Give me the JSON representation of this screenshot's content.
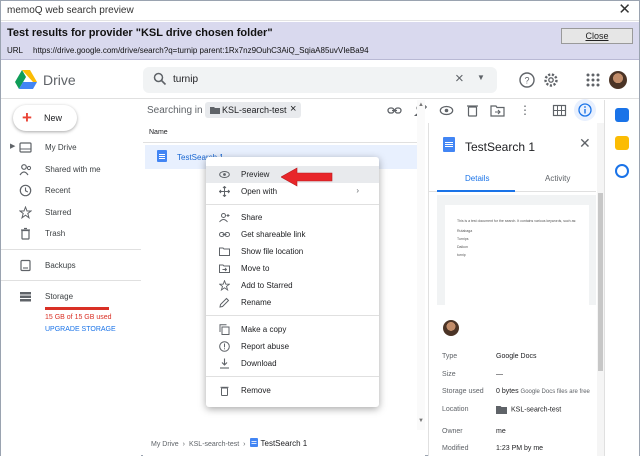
{
  "window": {
    "title": "memoQ web search preview",
    "heading": "Test results for provider \"KSL drive chosen folder\"",
    "url_label": "URL",
    "url": "https://drive.google.com/drive/search?q=turnip parent:1Rx7nz9OuhC3AiQ_SqiaA85uvVIeBa94",
    "close_label": "Close"
  },
  "header": {
    "logo_text": "Drive",
    "search_value": "turnip"
  },
  "sidebar": {
    "new_label": "New",
    "items": [
      {
        "label": "My Drive",
        "icon": "my-drive-icon"
      },
      {
        "label": "Shared with me",
        "icon": "shared-icon"
      },
      {
        "label": "Recent",
        "icon": "clock-icon"
      },
      {
        "label": "Starred",
        "icon": "star-icon"
      },
      {
        "label": "Trash",
        "icon": "trash-icon"
      }
    ],
    "backups_label": "Backups",
    "storage_label": "Storage",
    "storage_used": "15 GB of 15 GB used",
    "upgrade_label": "UPGRADE STORAGE"
  },
  "main": {
    "searching_in": "Searching in",
    "chip_label": "KSL-search-test",
    "column_name": "Name",
    "file_name": "TestSearch 1",
    "breadcrumb": [
      "My Drive",
      "KSL-search-test",
      "TestSearch 1"
    ]
  },
  "context_menu": {
    "items": [
      {
        "label": "Preview",
        "icon": "eye-icon"
      },
      {
        "label": "Open with",
        "icon": "move-arrows-icon"
      },
      {
        "label": "Share",
        "icon": "person-add-icon"
      },
      {
        "label": "Get shareable link",
        "icon": "link-icon"
      },
      {
        "label": "Show file location",
        "icon": "folder-icon"
      },
      {
        "label": "Move to",
        "icon": "folder-move-icon"
      },
      {
        "label": "Add to Starred",
        "icon": "star-icon"
      },
      {
        "label": "Rename",
        "icon": "pencil-icon"
      },
      {
        "label": "Make a copy",
        "icon": "copy-icon"
      },
      {
        "label": "Report abuse",
        "icon": "alert-icon"
      },
      {
        "label": "Download",
        "icon": "download-icon"
      },
      {
        "label": "Remove",
        "icon": "trash-icon"
      }
    ]
  },
  "details": {
    "title": "TestSearch 1",
    "tab_details": "Details",
    "tab_activity": "Activity",
    "preview_lines": [
      "This is a test document for the search. It contains various keywords, such as:",
      "Rutabaga",
      "Turnips",
      "Daikon",
      "turnip"
    ],
    "properties": [
      {
        "key": "Type",
        "value": "Google Docs"
      },
      {
        "key": "Size",
        "value": "—"
      },
      {
        "key": "Storage used",
        "value": "0 bytes",
        "note": "Google Docs files are free"
      },
      {
        "key": "Location",
        "value": "KSL-search-test"
      },
      {
        "key": "Owner",
        "value": "me"
      },
      {
        "key": "Modified",
        "value": "1:23 PM by me"
      }
    ]
  },
  "colors": {
    "accent": "#1a73e8",
    "danger": "#d93025",
    "selected_row": "#e8f0fe",
    "arrow": "#e8262a"
  }
}
